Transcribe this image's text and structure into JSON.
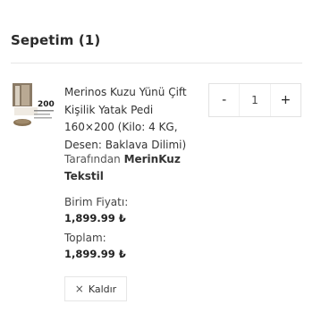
{
  "cart": {
    "title": "Sepetim (1)"
  },
  "item": {
    "name": "Merinos Kuzu Yünü Çift Kişilik Yatak Pedi 160×200 (Kilo: 4 KG, Desen: Baklava Dilimi)",
    "seller_prefix": "Tarafından",
    "seller_name": "MerinKuz Tekstil",
    "unit_price_label": "Birim Fiyatı:",
    "unit_price": "1,899.99 ₺",
    "total_label": "Toplam:",
    "total_price": "1,899.99 ₺",
    "quantity": "1",
    "decrement_label": "-",
    "increment_label": "+",
    "remove_label": "Kaldır",
    "thumbnail_text": "200"
  }
}
